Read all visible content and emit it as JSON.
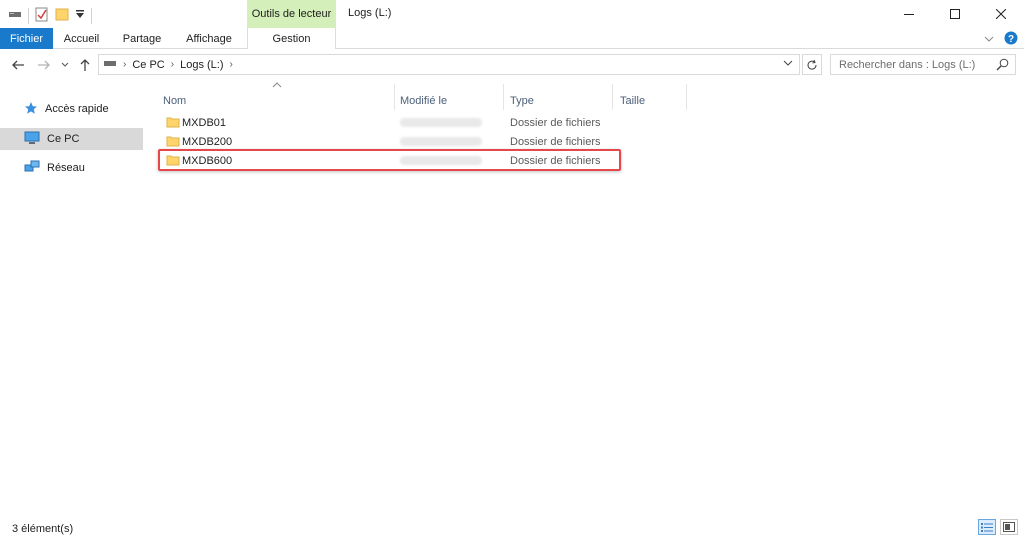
{
  "window": {
    "title": "Logs (L:)",
    "context_group": "Outils de lecteur"
  },
  "ribbon": {
    "tabs": [
      "Fichier",
      "Accueil",
      "Partage",
      "Affichage",
      "Gestion"
    ]
  },
  "address": {
    "crumbs": [
      "Ce PC",
      "Logs (L:)"
    ]
  },
  "search": {
    "placeholder": "Rechercher dans : Logs (L:)"
  },
  "nav": {
    "items": [
      {
        "label": "Accès rapide",
        "icon": "star-icon"
      },
      {
        "label": "Ce PC",
        "icon": "computer-icon",
        "selected": true
      },
      {
        "label": "Réseau",
        "icon": "network-icon"
      }
    ]
  },
  "columns": [
    "Nom",
    "Modifié le",
    "Type",
    "Taille"
  ],
  "files": [
    {
      "name": "MXDB01",
      "type": "Dossier de fichiers"
    },
    {
      "name": "MXDB200",
      "type": "Dossier de fichiers"
    },
    {
      "name": "MXDB600",
      "type": "Dossier de fichiers",
      "highlighted": true
    }
  ],
  "status": {
    "count": "3 élément(s)"
  },
  "colors": {
    "file_tab": "#1979ca",
    "context_tab": "#d4efb9",
    "highlight_border": "#e5484a",
    "header_text": "#4c607a"
  }
}
